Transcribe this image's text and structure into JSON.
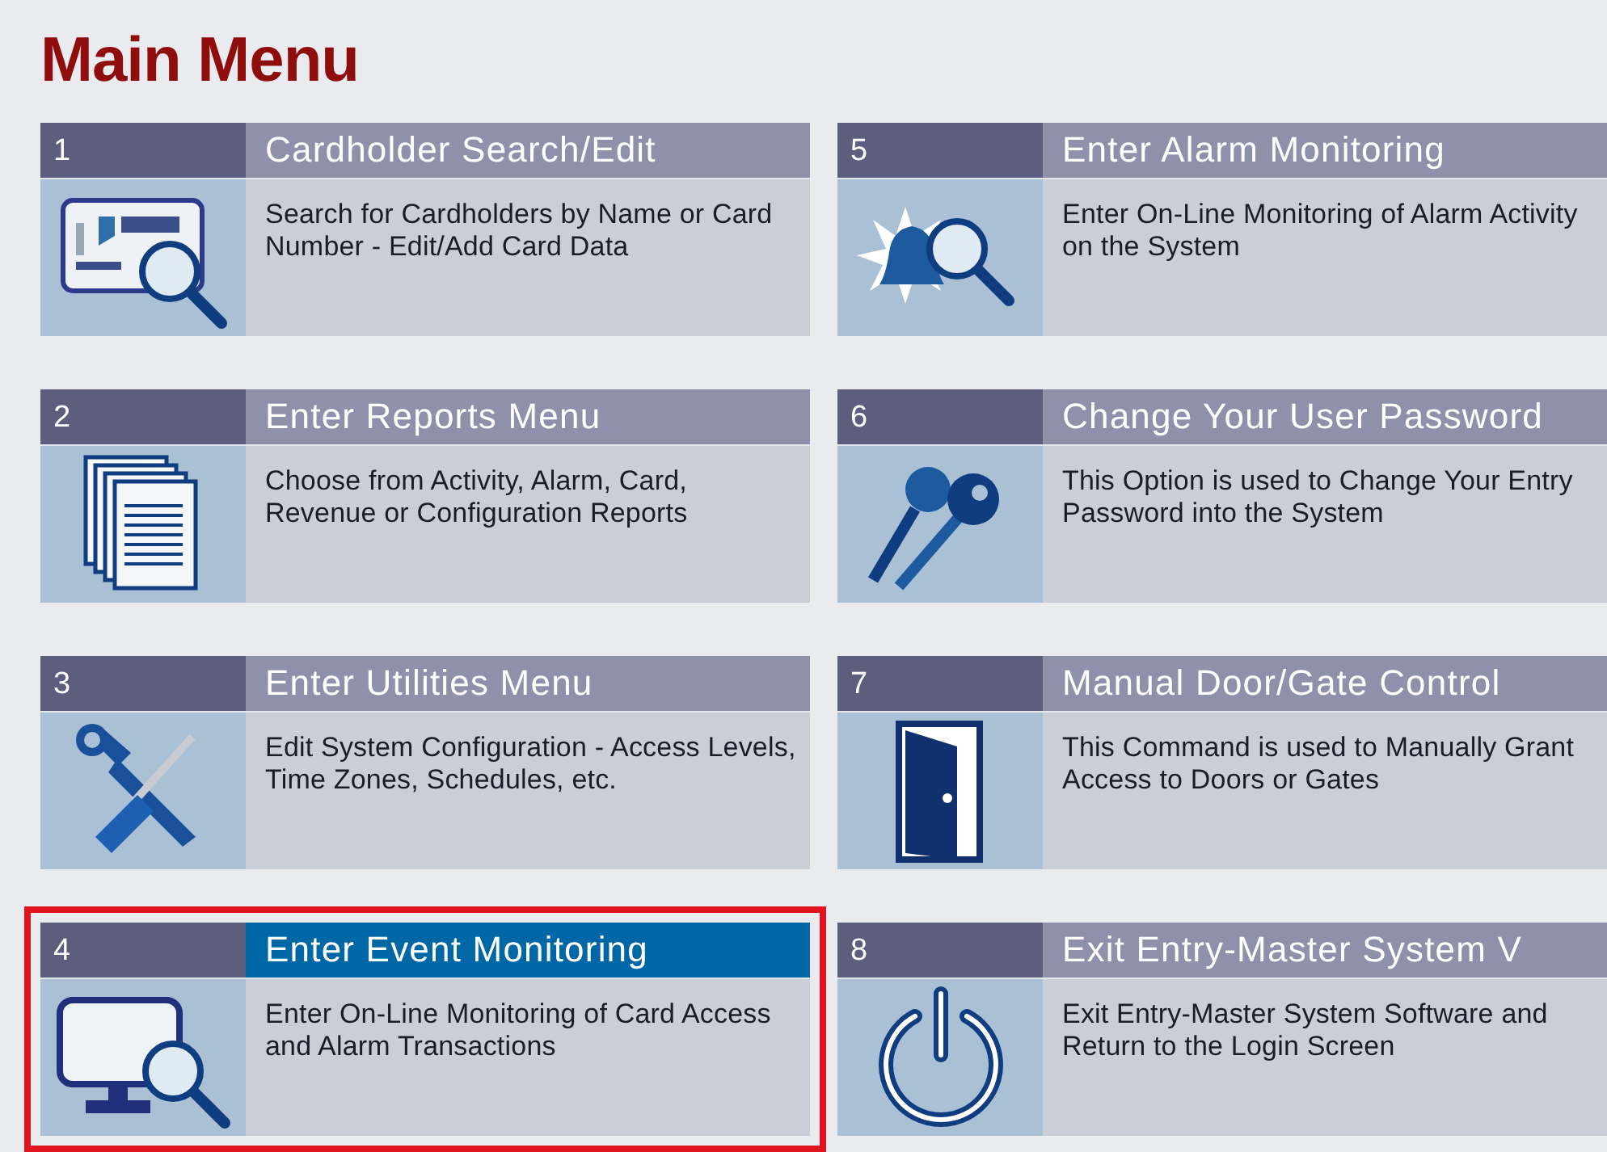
{
  "title": "Main Menu",
  "items": [
    {
      "number": "1",
      "title": "Cardholder Search/Edit",
      "description": "Search for Cardholders by Name or Card Number - Edit/Add Card Data",
      "kind": "card",
      "selected": false
    },
    {
      "number": "2",
      "title": "Enter Reports Menu",
      "description": "Choose from Activity, Alarm, Card, Revenue or Configuration Reports",
      "kind": "documents",
      "selected": false
    },
    {
      "number": "3",
      "title": "Enter Utilities Menu",
      "description": "Edit System Configuration - Access Levels, Time Zones, Schedules, etc.",
      "kind": "tools",
      "selected": false
    },
    {
      "number": "4",
      "title": "Enter Event Monitoring",
      "description": "Enter On-Line Monitoring of Card Access and Alarm Transactions",
      "kind": "monitor",
      "selected": true
    },
    {
      "number": "5",
      "title": "Enter Alarm Monitoring",
      "description": "Enter On-Line Monitoring of Alarm Activity on the System",
      "kind": "bell",
      "selected": false
    },
    {
      "number": "6",
      "title": "Change Your User Password",
      "description": "This Option is used to Change Your Entry Password into the System",
      "kind": "keys",
      "selected": false
    },
    {
      "number": "7",
      "title": "Manual Door/Gate Control",
      "description": "This Command is used to Manually Grant Access to Doors or Gates",
      "kind": "door",
      "selected": false
    },
    {
      "number": "8",
      "title": "Exit Entry-Master System V",
      "description": "Exit Entry-Master System Software and Return to the Login Screen",
      "kind": "power",
      "selected": false
    }
  ]
}
